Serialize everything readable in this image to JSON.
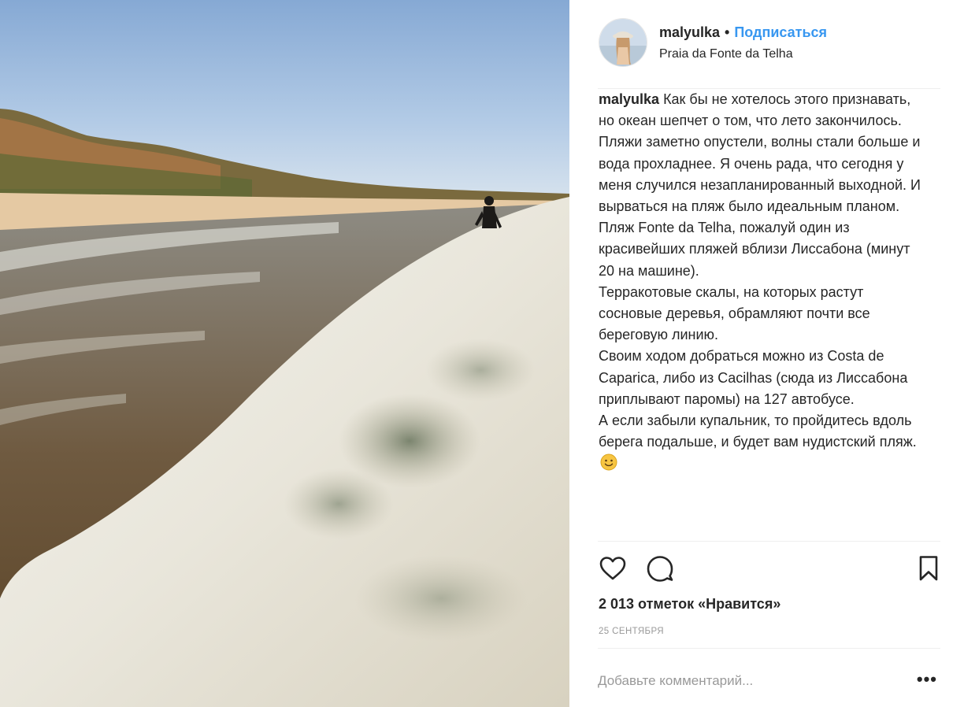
{
  "header": {
    "username": "malyulka",
    "separator": "•",
    "follow_label": "Подписаться",
    "location": "Praia da Fonte da Telha"
  },
  "caption": {
    "author": "malyulka",
    "paragraphs": [
      "Как бы не хотелось этого признавать, но океан шепчет о том, что лето закончилось. Пляжи заметно опустели, волны стали больше и вода прохладнее. Я очень рада, что сегодня у меня случился незапланированный выходной. И вырваться на пляж было идеальным планом.",
      "Пляж Fonte da Telha, пожалуй один из красивейших пляжей вблизи Лиссабона (минут 20 на машине).",
      "Терракотовые скалы, на которых растут сосновые деревья, обрамляют почти все береговую линию.",
      "Своим ходом добраться можно из Costa de Caparica, либо из Cacilhas (сюда из Лиссабона приплывают паромы) на 127 автобусе.",
      "А если забыли купальник, то пройдитесь вдоль берега подальше, и будет вам нудистский пляж."
    ],
    "emoji": "smiling-face-icon"
  },
  "actions": {
    "like_icon": "heart-icon",
    "comment_icon": "comment-bubble-icon",
    "save_icon": "bookmark-icon"
  },
  "likes_text": "2 013 отметок «Нравится»",
  "date_text": "25 сентября",
  "comment": {
    "placeholder": "Добавьте комментарий...",
    "more_label": "•••"
  },
  "colors": {
    "accent": "#3897f0",
    "text": "#262626",
    "muted": "#999999",
    "divider": "#efefef"
  }
}
